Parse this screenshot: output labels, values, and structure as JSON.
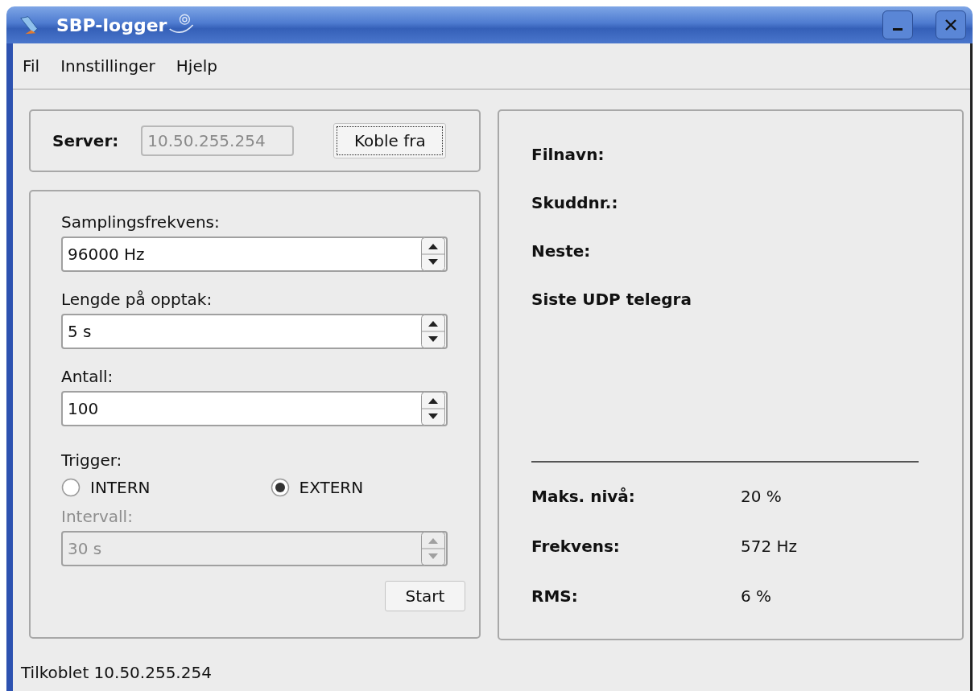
{
  "window": {
    "title": "SBP-logger"
  },
  "menu": [
    "Fil",
    "Innstillinger",
    "Hjelp"
  ],
  "server": {
    "label": "Server:",
    "value": "10.50.255.254",
    "disabled": true,
    "button": "Koble fra",
    "button_focused": true
  },
  "fields": [
    {
      "label": "Samplingsfrekvens:",
      "value": "96000 Hz",
      "disabled": false
    },
    {
      "label": "Lengde på opptak:",
      "value": "5 s",
      "disabled": false
    },
    {
      "label": "Antall:",
      "value": "100",
      "disabled": false
    }
  ],
  "trigger": {
    "label": "Trigger:",
    "options": [
      {
        "label": "INTERN",
        "selected": false
      },
      {
        "label": "EXTERN",
        "selected": true
      }
    ]
  },
  "interval": {
    "label": "Intervall:",
    "value": "30 s",
    "disabled": true
  },
  "start_button": "Start",
  "info": [
    {
      "label": "Filnavn:"
    },
    {
      "label": "Skuddnr.:"
    },
    {
      "label": "Neste:"
    },
    {
      "label": "Siste UDP telegra"
    }
  ],
  "stats": [
    {
      "label": "Maks. nivå:",
      "value": "20 %"
    },
    {
      "label": "Frekvens:",
      "value": "572 Hz"
    },
    {
      "label": "RMS:",
      "value": "6 %"
    }
  ],
  "status_bar": "Tilkoblet 10.50.255.254"
}
